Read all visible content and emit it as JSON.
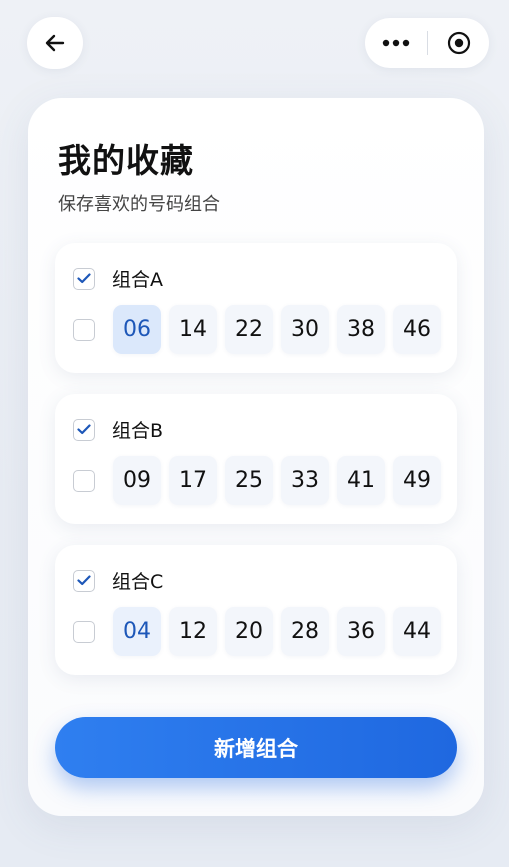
{
  "nav": {
    "back_icon": "arrow-left-icon",
    "more_icon": "more-dots-icon",
    "target_icon": "target-icon"
  },
  "header": {
    "title": "我的收藏",
    "subtitle": "保存喜欢的号码组合"
  },
  "groups": [
    {
      "name": "组合A",
      "header_checked": true,
      "row_checked": false,
      "numbers": [
        "06",
        "14",
        "22",
        "30",
        "38",
        "46"
      ],
      "selected_number": "06"
    },
    {
      "name": "组合B",
      "header_checked": true,
      "row_checked": false,
      "numbers": [
        "09",
        "17",
        "25",
        "33",
        "41",
        "49"
      ],
      "selected_number": ""
    },
    {
      "name": "组合C",
      "header_checked": true,
      "row_checked": false,
      "numbers": [
        "04",
        "12",
        "20",
        "28",
        "36",
        "44"
      ],
      "selected_number": "04"
    }
  ],
  "add_button": {
    "label": "新增组合"
  },
  "colors": {
    "accent": "#1f68e0",
    "check": "#1d57b8"
  }
}
